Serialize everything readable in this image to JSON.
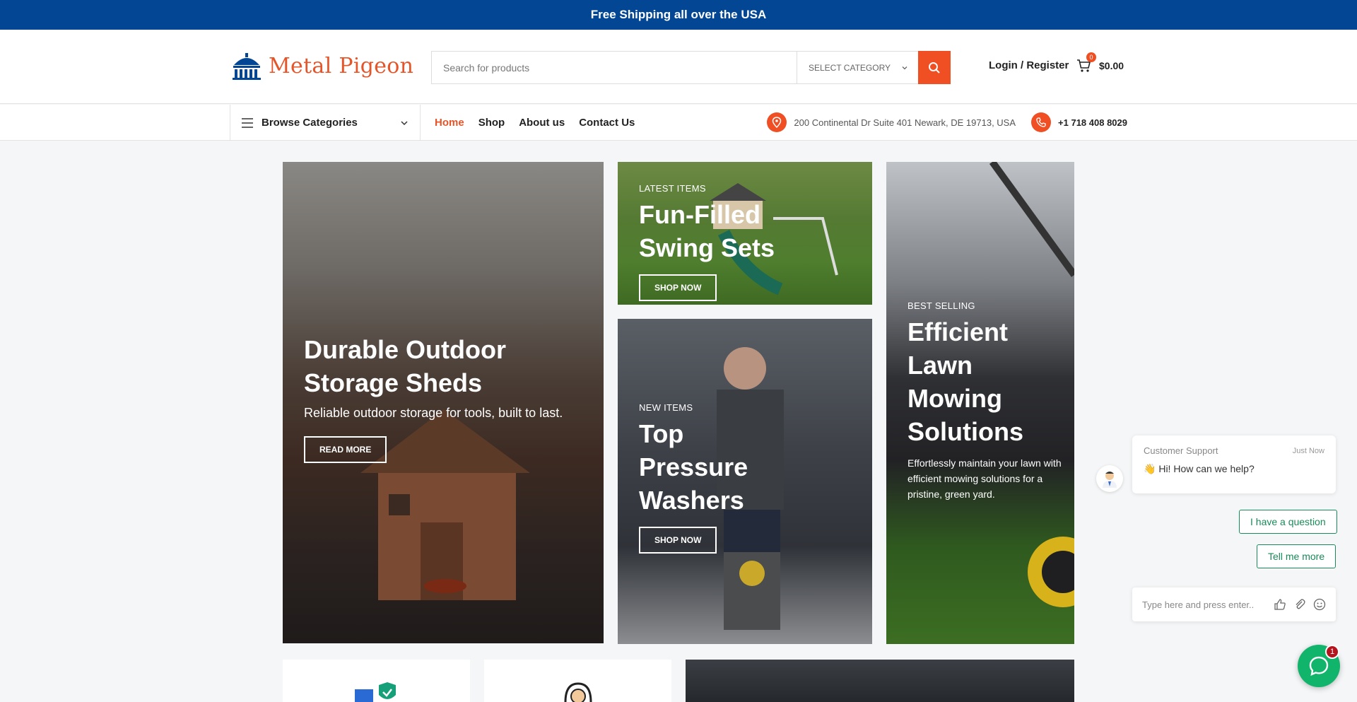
{
  "topbar": {
    "text": "Free Shipping all over the USA"
  },
  "header": {
    "logo_text": "Metal Pigeon",
    "search": {
      "placeholder": "Search for products",
      "category": "SELECT CATEGORY"
    },
    "login_label": "Login / Register",
    "cart": {
      "count": "0",
      "total": "$0.00"
    }
  },
  "nav": {
    "browse_label": "Browse Categories",
    "menu": [
      {
        "label": "Home"
      },
      {
        "label": "Shop"
      },
      {
        "label": "About us"
      },
      {
        "label": "Contact Us"
      }
    ],
    "address": "200 Continental Dr Suite 401 Newark, DE 19713, USA",
    "phone": "+1 718 408 8029"
  },
  "banners": {
    "shed": {
      "title_line1": "Durable Outdoor",
      "title_line2": "Storage Sheds",
      "text": "Reliable outdoor storage for tools, built to last.",
      "button": "READ MORE"
    },
    "swing": {
      "eyebrow": "LATEST ITEMS",
      "title_line1": "Fun-Filled",
      "title_line2": "Swing Sets",
      "button": "SHOP NOW"
    },
    "washer": {
      "eyebrow": "NEW ITEMS",
      "title_line1": "Top",
      "title_line2": "Pressure",
      "title_line3": "Washers",
      "button": "SHOP NOW"
    },
    "lawn": {
      "eyebrow": "BEST SELLING",
      "title_line1": "Efficient",
      "title_line2": "Lawn",
      "title_line3": "Mowing",
      "title_line4": "Solutions",
      "text": "Effortlessly maintain your lawn with efficient mowing solutions for a pristine, green yard."
    }
  },
  "chat": {
    "sender": "Customer Support",
    "time": "Just Now",
    "message": "Hi! How can we help?",
    "chips": [
      {
        "label": "I have a question"
      },
      {
        "label": "Tell me more"
      }
    ],
    "input_placeholder": "Type here and press enter..",
    "badge": "1"
  },
  "colors": {
    "brand": "#034694",
    "accent": "#f04e23",
    "chat": "#10b46a"
  }
}
